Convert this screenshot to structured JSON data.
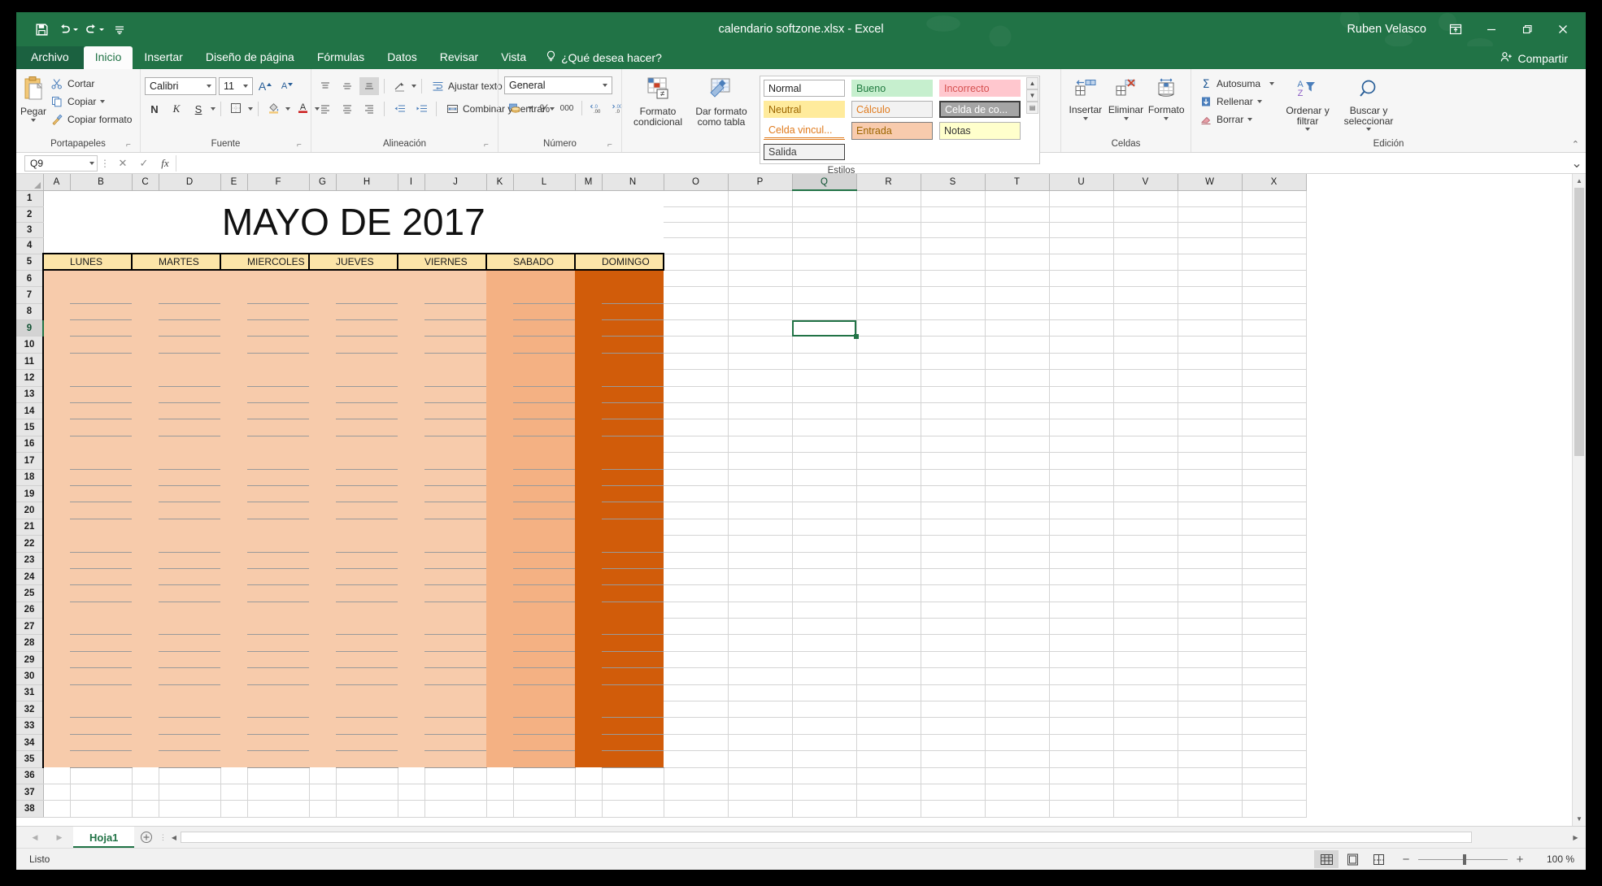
{
  "titlebar": {
    "file_title": "calendario softzone.xlsx  -  Excel",
    "user": "Ruben Velasco",
    "qat": [
      {
        "name": "save-icon",
        "label": "Guardar"
      },
      {
        "name": "undo-icon",
        "label": "Deshacer"
      },
      {
        "name": "redo-icon",
        "label": "Rehacer"
      },
      {
        "name": "customize-qat-icon",
        "label": "Personalizar barra de herramientas de acceso rápido"
      }
    ],
    "ribbon_display": "Opciones de presentación de la cinta de opciones",
    "minimize": "Minimizar",
    "restore": "Restaurar",
    "close": "Cerrar"
  },
  "tabs": [
    {
      "label": "Archivo",
      "active": false
    },
    {
      "label": "Inicio",
      "active": true
    },
    {
      "label": "Insertar",
      "active": false
    },
    {
      "label": "Diseño de página",
      "active": false
    },
    {
      "label": "Fórmulas",
      "active": false
    },
    {
      "label": "Datos",
      "active": false
    },
    {
      "label": "Revisar",
      "active": false
    },
    {
      "label": "Vista",
      "active": false
    }
  ],
  "tellme": "¿Qué desea hacer?",
  "share": "Compartir",
  "ribbon": {
    "clipboard": {
      "label": "Portapapeles",
      "paste": "Pegar",
      "cut": "Cortar",
      "copy": "Copiar",
      "format_painter": "Copiar formato"
    },
    "font": {
      "label": "Fuente",
      "family": "Calibri",
      "size": "11",
      "grow": "A",
      "shrink": "A",
      "bold": "N",
      "italic": "K",
      "underline": "S"
    },
    "alignment": {
      "label": "Alineación",
      "wrap_text": "Ajustar texto",
      "merge_center": "Combinar y centrar"
    },
    "number": {
      "label": "Número",
      "format": "General",
      "percent": "%",
      "thousands": "000"
    },
    "styles": {
      "label": "Estilos",
      "conditional_format": "Formato condicional",
      "format_as_table": "Dar formato como tabla",
      "gallery": [
        {
          "name": "Normal",
          "bg": "#ffffff",
          "fg": "#222222",
          "border": "#b0b0b0",
          "selected": false
        },
        {
          "name": "Bueno",
          "bg": "#c6efce",
          "fg": "#1f7a3f",
          "border": "",
          "selected": false
        },
        {
          "name": "Incorrecto",
          "bg": "#ffc7ce",
          "fg": "#d65050",
          "border": "",
          "selected": false
        },
        {
          "name": "Neutral",
          "bg": "#ffeb9c",
          "fg": "#9c6500",
          "border": "",
          "selected": false
        },
        {
          "name": "Cálculo",
          "bg": "#f2f2f2",
          "fg": "#e07b1e",
          "border": "#b0b0b0",
          "selected": false
        },
        {
          "name": "Celda de co...",
          "bg": "#a5a5a5",
          "fg": "#ffffff",
          "border": "#3f3f3f",
          "selected": true
        },
        {
          "name": "Celda vincul...",
          "bg": "#ffffff",
          "fg": "#e07b1e",
          "border": "",
          "selected": false
        },
        {
          "name": "Entrada",
          "bg": "#f8cbad",
          "fg": "#9c6500",
          "border": "#7f7f7f",
          "selected": false
        },
        {
          "name": "Notas",
          "bg": "#ffffcc",
          "fg": "#333333",
          "border": "#b2b2b2",
          "selected": false
        },
        {
          "name": "Salida",
          "bg": "#f2f2f2",
          "fg": "#3f3f3f",
          "border": "#3f3f3f",
          "selected": false
        }
      ]
    },
    "cells": {
      "label": "Celdas",
      "insert": "Insertar",
      "delete": "Eliminar",
      "format": "Formato"
    },
    "editing": {
      "label": "Edición",
      "autosum": "Autosuma",
      "fill": "Rellenar",
      "clear": "Borrar",
      "sort_filter": "Ordenar y filtrar",
      "find_select": "Buscar y seleccionar"
    }
  },
  "formula_bar": {
    "name_box": "Q9",
    "cancel": "✕",
    "enter": "✓",
    "insert_function": "fx",
    "value": "",
    "placeholder": ""
  },
  "grid": {
    "columns": [
      "A",
      "B",
      "C",
      "D",
      "E",
      "F",
      "G",
      "H",
      "I",
      "J",
      "K",
      "L",
      "M",
      "N",
      "O",
      "P",
      "Q",
      "R",
      "S",
      "T",
      "U",
      "V",
      "W",
      "X"
    ],
    "selected_column": "Q",
    "selected_row": "9",
    "selected_cell": "Q9",
    "rows": [
      "1",
      "2",
      "3",
      "4",
      "5",
      "6",
      "7",
      "8",
      "9",
      "10",
      "11",
      "12",
      "13",
      "14",
      "15",
      "16",
      "17",
      "18",
      "19",
      "20",
      "21",
      "22",
      "23",
      "24",
      "25",
      "26",
      "27",
      "28",
      "29",
      "30",
      "31",
      "32",
      "33",
      "34",
      "35",
      "36",
      "37",
      "38"
    ]
  },
  "calendar": {
    "title": "MAYO DE 2017",
    "title_row_span": "1-4",
    "header_row": "5",
    "days": [
      "LUNES",
      "MARTES",
      "MIERCOLES",
      "JUEVES",
      "VIERNES",
      "SABADO",
      "DOMINGO"
    ],
    "week_row_blocks": [
      "6-10",
      "11-15",
      "16-20",
      "21-25",
      "26-30",
      "31-35"
    ],
    "colors": {
      "header_bg": "#fce5a8",
      "weekday_bg": "#f7cbab",
      "saturday_bg": "#f4b183",
      "sunday_bg": "#d15c0a",
      "border": "#000000",
      "inner_line": "#9a9a9a"
    }
  },
  "sheets": {
    "tabs": [
      {
        "label": "Hoja1",
        "active": true
      }
    ],
    "add_label": "Hoja nueva"
  },
  "status": {
    "text": "Listo",
    "views": [
      {
        "name": "normal-view-icon",
        "label": "Normal",
        "active": true
      },
      {
        "name": "page-layout-view-icon",
        "label": "Diseño de página",
        "active": false
      },
      {
        "name": "page-break-view-icon",
        "label": "Vista previa de salto de página",
        "active": false
      }
    ],
    "zoom_out": "−",
    "zoom_in": "+",
    "zoom_value": "100 %"
  }
}
